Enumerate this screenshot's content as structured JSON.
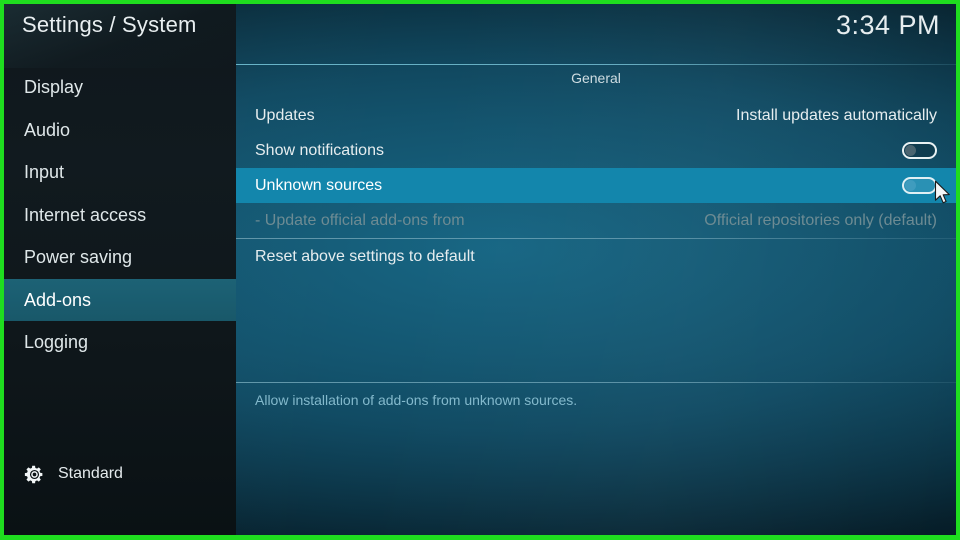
{
  "window": {
    "title": "Settings / System",
    "clock": "3:34 PM",
    "border_color": "#1fdd1f",
    "accent_color": "#1386ac",
    "sidebar_selected_color": "#1d6275"
  },
  "sidebar": {
    "items": [
      {
        "label": "Display",
        "selected": false
      },
      {
        "label": "Audio",
        "selected": false
      },
      {
        "label": "Input",
        "selected": false
      },
      {
        "label": "Internet access",
        "selected": false
      },
      {
        "label": "Power saving",
        "selected": false
      },
      {
        "label": "Add-ons",
        "selected": true
      },
      {
        "label": "Logging",
        "selected": false
      }
    ],
    "profile": {
      "icon": "gear-icon",
      "label": "Standard"
    }
  },
  "main": {
    "group_title": "General",
    "rows": [
      {
        "label": "Updates",
        "value": "Install updates automatically",
        "control": "text",
        "state": "normal"
      },
      {
        "label": "Show notifications",
        "value": "",
        "control": "toggle",
        "toggle_on": false,
        "state": "normal"
      },
      {
        "label": "Unknown sources",
        "value": "",
        "control": "toggle",
        "toggle_on": false,
        "state": "selected"
      },
      {
        "label": "- Update official add-ons from",
        "value": "Official repositories only (default)",
        "control": "text",
        "state": "disabled"
      },
      {
        "label": "Reset above settings to default",
        "value": "",
        "control": "none",
        "state": "normal"
      }
    ],
    "help_text": "Allow installation of add-ons from unknown sources."
  }
}
